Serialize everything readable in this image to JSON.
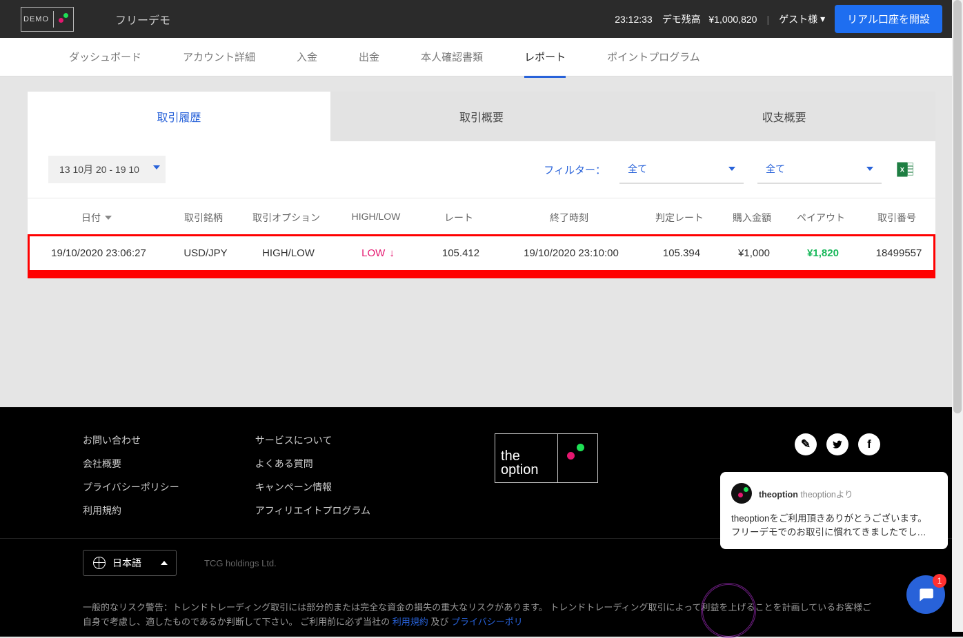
{
  "header": {
    "brand_mark": "DEMO",
    "title": "フリーデモ",
    "clock": "23:12:33",
    "balance_label": "デモ残高",
    "balance_value": "¥1,000,820",
    "guest_label": "ゲスト様",
    "cta": "リアル口座を開設"
  },
  "nav": {
    "dashboard": "ダッシュボード",
    "account": "アカウント詳細",
    "deposit": "入金",
    "withdraw": "出金",
    "kyc": "本人確認書類",
    "report": "レポート",
    "points": "ポイントプログラム"
  },
  "tabs": {
    "history": "取引履歴",
    "summary": "取引概要",
    "balance": "収支概要"
  },
  "filters": {
    "date_range": "13 10月 20  -  19 10",
    "label": "フィルター：",
    "option_all": "全て"
  },
  "table": {
    "headers": {
      "date": "日付",
      "asset": "取引銘柄",
      "option": "取引オプション",
      "highlow": "HIGH/LOW",
      "rate": "レート",
      "expiry": "終了時刻",
      "close_rate": "判定レート",
      "stake": "購入金額",
      "payout": "ペイアウト",
      "txid": "取引番号"
    },
    "rows": [
      {
        "date": "19/10/2020 23:06:27",
        "asset": "USD/JPY",
        "option": "HIGH/LOW",
        "position": "LOW",
        "rate": "105.412",
        "expiry": "19/10/2020 23:10:00",
        "close_rate": "105.394",
        "stake": "¥1,000",
        "payout": "¥1,820",
        "txid": "18499557"
      }
    ]
  },
  "footer": {
    "col1": {
      "contact": "お問い合わせ",
      "company": "会社概要",
      "privacy": "プライバシーポリシー",
      "terms": "利用規約"
    },
    "col2": {
      "about": "サービスについて",
      "faq": "よくある質問",
      "campaign": "キャンペーン情報",
      "affiliate": "アフィリエイトプログラム"
    },
    "logo_line1": "the",
    "logo_line2": "option",
    "lang": "日本語",
    "company_text": "TCG holdings Ltd.",
    "risk_text_1": "一般的なリスク警告：トレンドトレーディング取引には部分的または完全な資金の損失の重大なリスクがあります。 トレンドトレーディング取引によって利益を上げることを計画しているお客様ご自身で考慮し、適したものであるか判断して下さい。 ご利用前に必ず当社の",
    "risk_link_1": "利用規約",
    "risk_text_2": "及び",
    "risk_link_2": "プライバシーポリ"
  },
  "chat": {
    "from_name": "theoption",
    "from_suffix": " theoptionより",
    "line1": "theoptionをご利用頂きありがとうございます。",
    "line2": "フリーデモでのお取引に慣れてきましたでし…",
    "badge": "1"
  }
}
